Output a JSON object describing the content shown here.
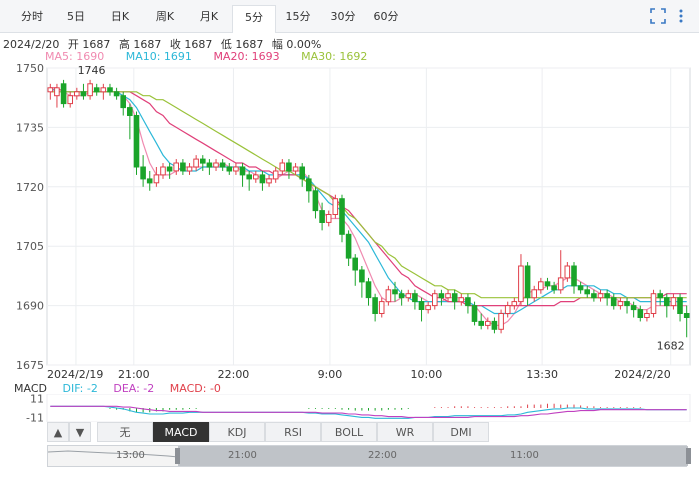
{
  "period_tabs": [
    "分时",
    "5日",
    "日K",
    "周K",
    "月K",
    "5分",
    "15分",
    "30分",
    "60分"
  ],
  "active_tab": "5分",
  "toolbar": {
    "fullscreen_icon": "fullscreen-icon",
    "more_icon": "more-vertical-icon"
  },
  "info": {
    "date": "2024/2/20",
    "open": "开 1687",
    "high": "高 1687",
    "close": "收 1687",
    "low": "低 1687",
    "change": "幅 0.00%"
  },
  "ma": {
    "ma5": "MA5: 1690",
    "ma10": "MA10: 1691",
    "ma20": "MA20: 1693",
    "ma30": "MA30: 1692"
  },
  "colors": {
    "up": "#e0404a",
    "down": "#1aa42a",
    "ma5": "#f08ab0",
    "ma10": "#2cb8d8",
    "ma20": "#e0407a",
    "ma30": "#9ac23a",
    "macd_dea": "#c040c0",
    "active_tab_bg": "#333333"
  },
  "chart_data": {
    "type": "candlestick",
    "yticks": [
      "1750",
      "1735",
      "1720",
      "1705",
      "1690",
      "1675"
    ],
    "ylim": [
      1675,
      1750
    ],
    "xticks": [
      "2024/2/19",
      "21:00",
      "22:00",
      "9:00",
      "10:00",
      "13:30",
      "2024/2/20"
    ],
    "max_label": "1746",
    "min_label": "1682",
    "candles": [
      [
        1744,
        1745,
        1742,
        1746
      ],
      [
        1743,
        1745,
        1740,
        1746
      ],
      [
        1746,
        1741,
        1740,
        1747
      ],
      [
        1741,
        1743,
        1740,
        1744
      ],
      [
        1743,
        1744,
        1742,
        1745
      ],
      [
        1744,
        1743,
        1742,
        1746
      ],
      [
        1743,
        1746,
        1742,
        1747
      ],
      [
        1745,
        1744,
        1743,
        1746
      ],
      [
        1744,
        1745,
        1742,
        1746
      ],
      [
        1745,
        1744,
        1743,
        1746
      ],
      [
        1744,
        1743,
        1742,
        1745
      ],
      [
        1743,
        1740,
        1738,
        1744
      ],
      [
        1740,
        1738,
        1732,
        1741
      ],
      [
        1738,
        1725,
        1723,
        1739
      ],
      [
        1725,
        1722,
        1720,
        1728
      ],
      [
        1722,
        1721,
        1719,
        1724
      ],
      [
        1721,
        1723,
        1720,
        1725
      ],
      [
        1723,
        1725,
        1722,
        1726
      ],
      [
        1725,
        1724,
        1722,
        1726
      ],
      [
        1724,
        1726,
        1723,
        1727
      ],
      [
        1726,
        1724,
        1723,
        1727
      ],
      [
        1724,
        1725,
        1723,
        1726
      ],
      [
        1725,
        1727,
        1724,
        1728
      ],
      [
        1727,
        1726,
        1724,
        1728
      ],
      [
        1726,
        1725,
        1723,
        1727
      ],
      [
        1725,
        1726,
        1724,
        1727
      ],
      [
        1726,
        1725,
        1724,
        1727
      ],
      [
        1725,
        1724,
        1723,
        1726
      ],
      [
        1724,
        1725,
        1723,
        1726
      ],
      [
        1725,
        1723,
        1720,
        1726
      ],
      [
        1723,
        1722,
        1719,
        1724
      ],
      [
        1722,
        1723,
        1721,
        1724
      ],
      [
        1723,
        1721,
        1719,
        1724
      ],
      [
        1721,
        1722,
        1720,
        1723
      ],
      [
        1722,
        1724,
        1721,
        1725
      ],
      [
        1724,
        1726,
        1723,
        1727
      ],
      [
        1726,
        1724,
        1722,
        1727
      ],
      [
        1724,
        1725,
        1723,
        1726
      ],
      [
        1725,
        1722,
        1720,
        1726
      ],
      [
        1722,
        1719,
        1716,
        1723
      ],
      [
        1719,
        1714,
        1712,
        1720
      ],
      [
        1714,
        1711,
        1709,
        1716
      ],
      [
        1711,
        1713,
        1710,
        1714
      ],
      [
        1713,
        1717,
        1712,
        1718
      ],
      [
        1717,
        1708,
        1706,
        1718
      ],
      [
        1708,
        1702,
        1700,
        1709
      ],
      [
        1702,
        1699,
        1695,
        1703
      ],
      [
        1699,
        1696,
        1692,
        1700
      ],
      [
        1696,
        1692,
        1690,
        1697
      ],
      [
        1692,
        1688,
        1686,
        1693
      ],
      [
        1688,
        1691,
        1687,
        1692
      ],
      [
        1691,
        1694,
        1690,
        1695
      ],
      [
        1694,
        1693,
        1691,
        1696
      ],
      [
        1693,
        1692,
        1690,
        1694
      ],
      [
        1692,
        1693,
        1691,
        1694
      ],
      [
        1693,
        1691,
        1689,
        1694
      ],
      [
        1691,
        1689,
        1686,
        1692
      ],
      [
        1689,
        1690,
        1688,
        1691
      ],
      [
        1690,
        1693,
        1689,
        1694
      ],
      [
        1693,
        1692,
        1690,
        1694
      ],
      [
        1692,
        1693,
        1691,
        1694
      ],
      [
        1693,
        1691,
        1689,
        1694
      ],
      [
        1691,
        1692,
        1690,
        1693
      ],
      [
        1692,
        1690,
        1688,
        1693
      ],
      [
        1690,
        1686,
        1685,
        1691
      ],
      [
        1686,
        1685,
        1684,
        1688
      ],
      [
        1685,
        1686,
        1684,
        1687
      ],
      [
        1686,
        1684,
        1683,
        1687
      ],
      [
        1684,
        1688,
        1683,
        1689
      ],
      [
        1688,
        1690,
        1687,
        1691
      ],
      [
        1690,
        1691,
        1689,
        1692
      ],
      [
        1691,
        1700,
        1690,
        1703
      ],
      [
        1700,
        1692,
        1690,
        1701
      ],
      [
        1692,
        1694,
        1691,
        1695
      ],
      [
        1694,
        1696,
        1693,
        1697
      ],
      [
        1696,
        1695,
        1694,
        1697
      ],
      [
        1695,
        1694,
        1693,
        1696
      ],
      [
        1694,
        1697,
        1693,
        1704
      ],
      [
        1697,
        1700,
        1696,
        1701
      ],
      [
        1700,
        1695,
        1693,
        1701
      ],
      [
        1695,
        1694,
        1693,
        1696
      ],
      [
        1694,
        1693,
        1692,
        1695
      ],
      [
        1693,
        1692,
        1691,
        1694
      ],
      [
        1692,
        1693,
        1691,
        1694
      ],
      [
        1693,
        1692,
        1690,
        1694
      ],
      [
        1692,
        1690,
        1689,
        1693
      ],
      [
        1690,
        1691,
        1689,
        1692
      ],
      [
        1691,
        1690,
        1688,
        1692
      ],
      [
        1690,
        1689,
        1687,
        1691
      ],
      [
        1689,
        1687,
        1686,
        1690
      ],
      [
        1687,
        1688,
        1686,
        1689
      ],
      [
        1688,
        1693,
        1687,
        1694
      ],
      [
        1693,
        1692,
        1690,
        1694
      ],
      [
        1692,
        1690,
        1687,
        1693
      ],
      [
        1690,
        1692,
        1689,
        1693
      ],
      [
        1692,
        1688,
        1686,
        1693
      ],
      [
        1688,
        1687,
        1682,
        1690
      ]
    ],
    "ma_series": [
      {
        "name": "MA5",
        "values": [
          1745,
          1744,
          1744,
          1743,
          1743,
          1743,
          1744,
          1744,
          1744,
          1744,
          1744,
          1743,
          1741,
          1737,
          1731,
          1726,
          1723,
          1723,
          1723,
          1724,
          1725,
          1725,
          1725,
          1725,
          1725,
          1725,
          1726,
          1725,
          1725,
          1724,
          1724,
          1723,
          1722,
          1722,
          1722,
          1723,
          1724,
          1724,
          1724,
          1722,
          1718,
          1714,
          1712,
          1712,
          1712,
          1710,
          1707,
          1703,
          1699,
          1695,
          1692,
          1691,
          1691,
          1692,
          1693,
          1693,
          1692,
          1691,
          1691,
          1691,
          1692,
          1692,
          1692,
          1691,
          1690,
          1688,
          1686,
          1685,
          1685,
          1686,
          1688,
          1691,
          1693,
          1694,
          1694,
          1695,
          1695,
          1696,
          1697,
          1697,
          1696,
          1695,
          1694,
          1693,
          1693,
          1692,
          1691,
          1691,
          1690,
          1689,
          1689,
          1690,
          1690,
          1690,
          1690,
          1690,
          1690
        ]
      },
      {
        "name": "MA10",
        "values": [
          1745,
          1744,
          1744,
          1744,
          1744,
          1744,
          1744,
          1744,
          1744,
          1744,
          1744,
          1743,
          1742,
          1740,
          1737,
          1734,
          1731,
          1728,
          1726,
          1725,
          1724,
          1724,
          1724,
          1725,
          1725,
          1725,
          1725,
          1725,
          1725,
          1725,
          1724,
          1724,
          1724,
          1723,
          1723,
          1723,
          1723,
          1723,
          1723,
          1722,
          1720,
          1718,
          1716,
          1715,
          1714,
          1712,
          1710,
          1708,
          1706,
          1703,
          1700,
          1697,
          1695,
          1693,
          1692,
          1691,
          1691,
          1691,
          1691,
          1691,
          1691,
          1691,
          1691,
          1691,
          1690,
          1690,
          1689,
          1688,
          1688,
          1688,
          1688,
          1689,
          1690,
          1691,
          1692,
          1693,
          1694,
          1694,
          1695,
          1695,
          1695,
          1695,
          1695,
          1694,
          1694,
          1693,
          1693,
          1692,
          1692,
          1691,
          1691,
          1691,
          1691,
          1691,
          1691,
          1691,
          1691
        ]
      },
      {
        "name": "MA20",
        "values": [
          1745,
          1745,
          1744,
          1744,
          1744,
          1744,
          1744,
          1744,
          1744,
          1744,
          1744,
          1744,
          1744,
          1743,
          1742,
          1741,
          1739,
          1738,
          1736,
          1735,
          1734,
          1733,
          1732,
          1731,
          1730,
          1729,
          1728,
          1727,
          1726,
          1726,
          1725,
          1725,
          1724,
          1724,
          1723,
          1723,
          1723,
          1723,
          1722,
          1721,
          1720,
          1719,
          1718,
          1717,
          1715,
          1714,
          1712,
          1710,
          1708,
          1706,
          1704,
          1702,
          1700,
          1698,
          1697,
          1695,
          1694,
          1693,
          1692,
          1692,
          1691,
          1691,
          1691,
          1690,
          1690,
          1690,
          1690,
          1690,
          1690,
          1690,
          1690,
          1690,
          1690,
          1690,
          1690,
          1690,
          1690,
          1691,
          1691,
          1691,
          1692,
          1692,
          1692,
          1692,
          1692,
          1692,
          1692,
          1692,
          1692,
          1692,
          1692,
          1692,
          1692,
          1693,
          1693,
          1693,
          1693
        ]
      },
      {
        "name": "MA30",
        "values": [
          1744,
          1744,
          1744,
          1744,
          1744,
          1744,
          1744,
          1744,
          1744,
          1744,
          1744,
          1744,
          1744,
          1744,
          1743,
          1743,
          1742,
          1742,
          1741,
          1740,
          1739,
          1738,
          1737,
          1736,
          1735,
          1734,
          1733,
          1732,
          1731,
          1730,
          1729,
          1728,
          1727,
          1726,
          1725,
          1724,
          1724,
          1723,
          1722,
          1721,
          1720,
          1719,
          1718,
          1716,
          1715,
          1713,
          1712,
          1710,
          1708,
          1706,
          1705,
          1703,
          1702,
          1700,
          1699,
          1698,
          1697,
          1696,
          1695,
          1695,
          1694,
          1694,
          1693,
          1693,
          1693,
          1692,
          1692,
          1692,
          1692,
          1692,
          1692,
          1692,
          1692,
          1692,
          1692,
          1692,
          1692,
          1692,
          1692,
          1692,
          1692,
          1692,
          1692,
          1692,
          1692,
          1692,
          1692,
          1692,
          1692,
          1692,
          1692,
          1692,
          1692,
          1692,
          1692,
          1692,
          1692
        ]
      }
    ]
  },
  "macd": {
    "dif": "DIF: -2",
    "dea": "DEA: -2",
    "macd": "MACD: -0",
    "yticks": [
      "11",
      "-11"
    ],
    "ylim": [
      -14,
      14
    ],
    "dif_values": [
      2,
      2,
      2,
      2,
      2,
      2,
      2,
      2,
      2,
      1,
      0,
      -1,
      -3,
      -5,
      -6,
      -7,
      -7,
      -7,
      -6,
      -6,
      -6,
      -5,
      -5,
      -5,
      -5,
      -5,
      -5,
      -5,
      -5,
      -5,
      -5,
      -5,
      -5,
      -5,
      -5,
      -5,
      -5,
      -5,
      -5,
      -6,
      -6,
      -7,
      -7,
      -7,
      -8,
      -9,
      -10,
      -11,
      -11,
      -12,
      -12,
      -12,
      -12,
      -12,
      -12,
      -11,
      -11,
      -11,
      -10,
      -10,
      -10,
      -9,
      -9,
      -9,
      -9,
      -9,
      -9,
      -9,
      -9,
      -8,
      -8,
      -7,
      -5,
      -4,
      -3,
      -2,
      -1,
      -1,
      0,
      0,
      0,
      -1,
      -1,
      -1,
      -1,
      -1,
      -1,
      -1,
      -1,
      -1,
      -2,
      -2,
      -2,
      -2,
      -2,
      -2,
      -2
    ],
    "dea_values": [
      2,
      2,
      2,
      2,
      2,
      2,
      2,
      2,
      2,
      2,
      2,
      1,
      1,
      0,
      -1,
      -2,
      -3,
      -3,
      -4,
      -4,
      -4,
      -4,
      -4,
      -5,
      -5,
      -5,
      -5,
      -5,
      -5,
      -5,
      -5,
      -5,
      -5,
      -5,
      -5,
      -5,
      -5,
      -5,
      -5,
      -5,
      -5,
      -6,
      -6,
      -6,
      -6,
      -7,
      -7,
      -8,
      -8,
      -9,
      -9,
      -10,
      -10,
      -10,
      -11,
      -11,
      -11,
      -11,
      -11,
      -11,
      -11,
      -11,
      -11,
      -11,
      -10,
      -10,
      -10,
      -10,
      -10,
      -10,
      -10,
      -9,
      -9,
      -8,
      -7,
      -7,
      -6,
      -5,
      -4,
      -4,
      -3,
      -3,
      -3,
      -2,
      -2,
      -2,
      -2,
      -2,
      -2,
      -2,
      -2,
      -2,
      -2,
      -2,
      -2,
      -2,
      -2
    ],
    "hist_values": [
      0,
      0,
      0,
      0,
      0,
      0,
      0,
      0,
      0,
      -1,
      -2,
      -2,
      -4,
      -5,
      -5,
      -5,
      -4,
      -4,
      -2,
      -2,
      -2,
      -1,
      -1,
      0,
      0,
      0,
      0,
      0,
      0,
      0,
      0,
      0,
      0,
      0,
      0,
      0,
      0,
      0,
      0,
      -1,
      -1,
      -1,
      -1,
      -1,
      -2,
      -2,
      -3,
      -3,
      -3,
      -3,
      -3,
      -2,
      -2,
      -2,
      -1,
      0,
      0,
      0,
      1,
      1,
      1,
      2,
      2,
      2,
      1,
      1,
      1,
      1,
      1,
      2,
      2,
      2,
      4,
      4,
      4,
      5,
      5,
      4,
      4,
      4,
      3,
      2,
      2,
      1,
      1,
      1,
      1,
      1,
      1,
      1,
      0,
      0,
      0,
      0,
      0,
      0,
      0
    ]
  },
  "indicator_tabs": [
    "无",
    "MACD",
    "KDJ",
    "RSI",
    "BOLL",
    "WR",
    "DMI"
  ],
  "active_indicator": "MACD",
  "scroller": {
    "labels": [
      "13:00",
      "21:00",
      "22:00",
      "11:00"
    ],
    "up_arrow": "▲",
    "down_arrow": "▼"
  }
}
